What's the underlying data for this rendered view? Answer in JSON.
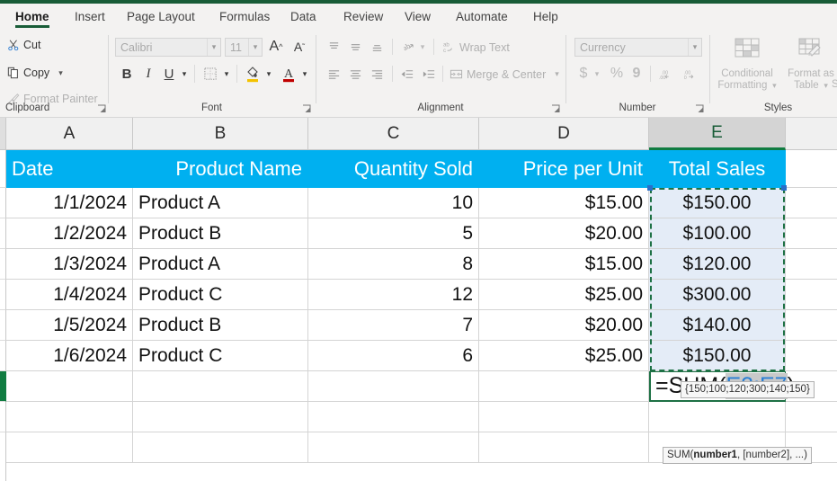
{
  "app": {
    "accent_green": "#185c37",
    "ribbon_bg": "#f3f2f1",
    "header_fill": "#00b0f0",
    "selection_fill": "#e4ecf7",
    "marquee_color": "#1e7145"
  },
  "ribbon": {
    "tabs": [
      {
        "label": "Home",
        "active": true
      },
      {
        "label": "Insert",
        "active": false
      },
      {
        "label": "Page Layout",
        "active": false
      },
      {
        "label": "Formulas",
        "active": false
      },
      {
        "label": "Data",
        "active": false
      },
      {
        "label": "Review",
        "active": false
      },
      {
        "label": "View",
        "active": false
      },
      {
        "label": "Automate",
        "active": false
      },
      {
        "label": "Help",
        "active": false
      }
    ],
    "groups": {
      "clipboard": {
        "label": "Clipboard",
        "cut": "Cut",
        "copy": "Copy",
        "format_painter": "Format Painter"
      },
      "font": {
        "label": "Font",
        "font_name": "Calibri",
        "font_size": "11",
        "grow_font": "A",
        "shrink_font": "A",
        "bold": "B",
        "italic": "I",
        "underline": "U"
      },
      "alignment": {
        "label": "Alignment",
        "wrap_text": "Wrap Text",
        "merge_center": "Merge & Center"
      },
      "number": {
        "label": "Number",
        "format": "Currency",
        "accounting": "$",
        "percent": "%",
        "comma": "9"
      },
      "styles": {
        "label": "Styles",
        "conditional_formatting": "Conditional Formatting",
        "format_as_table": "Format as Table",
        "cell_styles": "S"
      }
    }
  },
  "grid": {
    "columns": [
      {
        "letter": "A",
        "selected": false
      },
      {
        "letter": "B",
        "selected": false
      },
      {
        "letter": "C",
        "selected": false
      },
      {
        "letter": "D",
        "selected": false
      },
      {
        "letter": "E",
        "selected": true
      }
    ],
    "header_row": [
      "Date",
      "Product Name",
      "Quantity Sold",
      "Price per Unit",
      "Total Sales"
    ],
    "rows": [
      {
        "date": "1/1/2024",
        "product": "Product A",
        "qty": "10",
        "price": "$15.00",
        "total": "$150.00"
      },
      {
        "date": "1/2/2024",
        "product": "Product B",
        "qty": "5",
        "price": "$20.00",
        "total": "$100.00"
      },
      {
        "date": "1/3/2024",
        "product": "Product A",
        "qty": "8",
        "price": "$15.00",
        "total": "$120.00"
      },
      {
        "date": "1/4/2024",
        "product": "Product C",
        "qty": "12",
        "price": "$25.00",
        "total": "$300.00"
      },
      {
        "date": "1/5/2024",
        "product": "Product B",
        "qty": "7",
        "price": "$20.00",
        "total": "$140.00"
      },
      {
        "date": "1/6/2024",
        "product": "Product C",
        "qty": "6",
        "price": "$25.00",
        "total": "$150.00"
      }
    ]
  },
  "formula_entry": {
    "prefix": "=SUM(",
    "range": "E2:E7",
    "suffix": ")",
    "array_preview": "{150;100;120;300;140;150}",
    "signature_name": "SUM(",
    "signature_arg1": "number1",
    "signature_rest": ", [number2], ...)"
  }
}
